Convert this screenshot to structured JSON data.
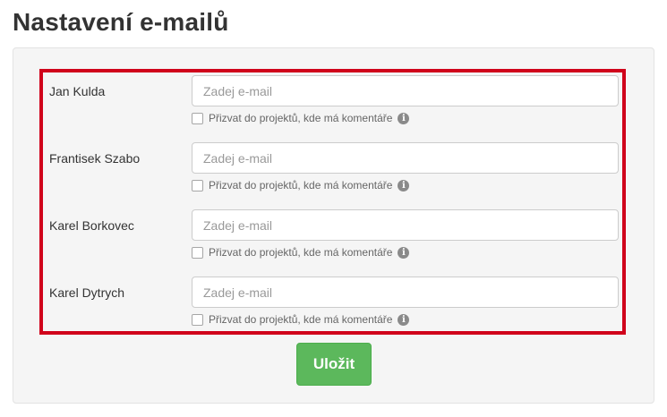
{
  "page": {
    "title": "Nastavení e-mailů"
  },
  "users": [
    {
      "name": "Jan Kulda",
      "email_value": "",
      "email_placeholder": "Zadej e-mail",
      "invite_label": "Přizvat do projektů, kde má komentáře",
      "invite_checked": false
    },
    {
      "name": "Frantisek Szabo",
      "email_value": "",
      "email_placeholder": "Zadej e-mail",
      "invite_label": "Přizvat do projektů, kde má komentáře",
      "invite_checked": false
    },
    {
      "name": "Karel Borkovec",
      "email_value": "",
      "email_placeholder": "Zadej e-mail",
      "invite_label": "Přizvat do projektů, kde má komentáře",
      "invite_checked": false
    },
    {
      "name": "Karel Dytrych",
      "email_value": "",
      "email_placeholder": "Zadej e-mail",
      "invite_label": "Přizvat do projektů, kde má komentáře",
      "invite_checked": false
    }
  ],
  "icons": {
    "info": "info-icon"
  },
  "actions": {
    "save_label": "Uložit"
  },
  "colors": {
    "highlight": "#d0021b",
    "save_button": "#5cb85c",
    "panel_background": "#f5f5f5"
  }
}
